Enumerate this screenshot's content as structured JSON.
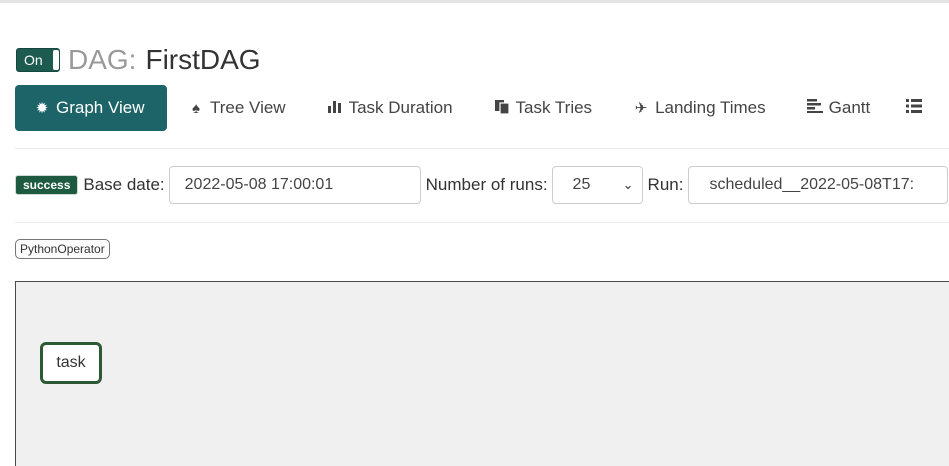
{
  "header": {
    "toggle_label": "On",
    "dag_prefix": "DAG:",
    "dag_name": "FirstDAG"
  },
  "nav": {
    "tabs": [
      {
        "label": "Graph View",
        "icon": "sun-icon",
        "active": true
      },
      {
        "label": "Tree View",
        "icon": "tree-icon"
      },
      {
        "label": "Task Duration",
        "icon": "bar-chart-icon"
      },
      {
        "label": "Task Tries",
        "icon": "duplicate-icon"
      },
      {
        "label": "Landing Times",
        "icon": "plane-icon"
      },
      {
        "label": "Gantt",
        "icon": "align-left-icon"
      },
      {
        "label": "",
        "icon": "list-icon"
      }
    ]
  },
  "controls": {
    "status_badge": "success",
    "base_date_label": "Base date:",
    "base_date_value": "2022-05-08 17:00:01",
    "num_runs_label": "Number of runs:",
    "num_runs_value": "25",
    "run_label": "Run:",
    "run_value": "scheduled__2022-05-08T17:"
  },
  "legend": {
    "operators": [
      "PythonOperator"
    ]
  },
  "graph": {
    "nodes": [
      {
        "label": "task",
        "state_color": "#2d5a33"
      }
    ]
  },
  "colors": {
    "accent": "#1d6468",
    "toggle": "#1d5b50",
    "success": "#1e5a3f"
  }
}
